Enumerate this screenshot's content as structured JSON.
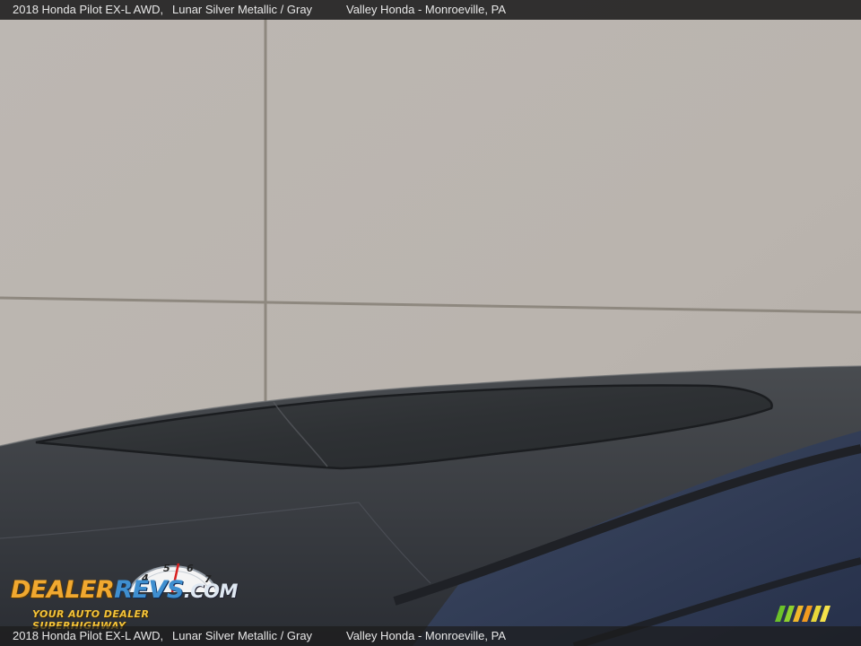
{
  "caption": {
    "vehicle": "2018 Honda Pilot EX-L AWD,",
    "color": "Lunar Silver Metallic / Gray",
    "dealer": "Valley Honda - Monroeville, PA"
  },
  "watermark": {
    "brand_dealer": "DEALER",
    "brand_revs": "REVS",
    "brand_com": ".COM",
    "tagline": "YOUR AUTO DEALER SUPERHIGHWAY",
    "gauge_numbers": [
      "4",
      "5",
      "6",
      "7"
    ]
  },
  "photo": {
    "subject": "car roof with sunroof in front of a concrete wall",
    "colors": {
      "wall": "#bcb6b0",
      "wall_joint": "#8f897f",
      "roof": "#35393f",
      "sunroof_glass": "#2a2d30",
      "body_blue": "#3e4a61"
    }
  }
}
